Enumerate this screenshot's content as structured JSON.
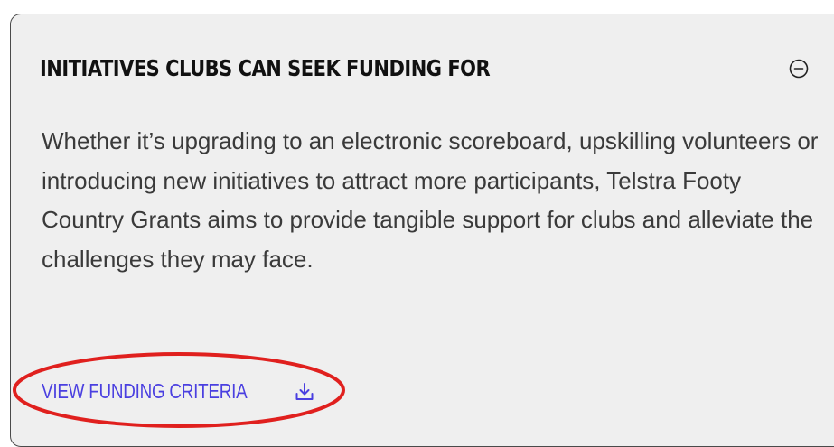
{
  "card": {
    "title": "INITIATIVES CLUBS CAN SEEK FUNDING FOR",
    "collapse_icon": "minus-circle-icon",
    "body": "Whether it’s upgrading to an electronic scoreboard, upskilling volunteers or introducing new initiatives to attract more participants, Telstra Footy Country Grants aims to provide tangible support for clubs and alleviate the challenges they may face.",
    "cta_label": "VIEW FUNDING CRITERIA",
    "cta_icon": "download-icon"
  },
  "colors": {
    "card_background": "#efefef",
    "card_border": "#4a4a4a",
    "title": "#111111",
    "body_text": "#3a3a3a",
    "link": "#4a3fe0",
    "annotation": "#e0201e"
  }
}
